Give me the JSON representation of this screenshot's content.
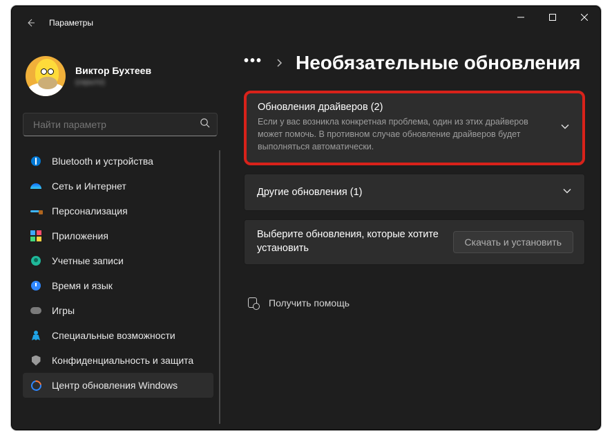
{
  "titlebar": {
    "label": "Параметры"
  },
  "profile": {
    "name": "Виктор Бухтеев",
    "sub": "(скрыто)"
  },
  "search": {
    "placeholder": "Найти параметр"
  },
  "nav": {
    "items": [
      {
        "label": "Bluetooth и устройства"
      },
      {
        "label": "Сеть и Интернет"
      },
      {
        "label": "Персонализация"
      },
      {
        "label": "Приложения"
      },
      {
        "label": "Учетные записи"
      },
      {
        "label": "Время и язык"
      },
      {
        "label": "Игры"
      },
      {
        "label": "Специальные возможности"
      },
      {
        "label": "Конфиденциальность и защита"
      },
      {
        "label": "Центр обновления Windows"
      }
    ]
  },
  "breadcrumb": {
    "ellipsis": "•••",
    "title": "Необязательные обновления"
  },
  "cards": {
    "drivers": {
      "title": "Обновления драйверов (2)",
      "sub": "Если у вас возникла конкретная проблема, один из этих драйверов может помочь. В противном случае обновление драйверов будет выполняться автоматически."
    },
    "other": {
      "title": "Другие обновления (1)"
    },
    "action": {
      "text": "Выберите обновления, которые хотите установить",
      "button": "Скачать и установить"
    }
  },
  "help": {
    "label": "Получить помощь"
  }
}
